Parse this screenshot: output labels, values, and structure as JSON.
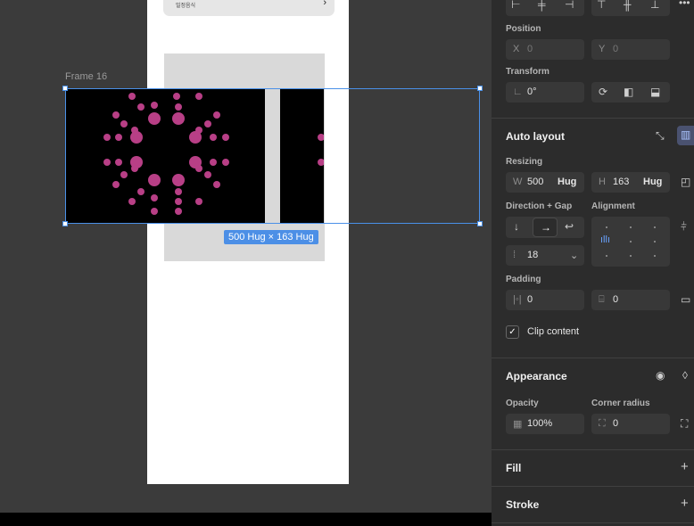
{
  "canvas": {
    "frame_label": "Frame 16",
    "size_badge": "500 Hug × 163 Hug",
    "top_card_text": "밀정음식",
    "dot_color": "#b83f86"
  },
  "panel": {
    "position": {
      "title": "Position",
      "x_key": "X",
      "x_value": "0",
      "y_key": "Y",
      "y_value": "0"
    },
    "transform": {
      "title": "Transform",
      "rotation": "0°"
    },
    "auto_layout": {
      "title": "Auto layout",
      "resizing_title": "Resizing",
      "w_key": "W",
      "w_value": "500",
      "w_mode": "Hug",
      "h_key": "H",
      "h_value": "163",
      "h_mode": "Hug",
      "direction_title": "Direction + Gap",
      "alignment_title": "Alignment",
      "gap_value": "18",
      "padding_title": "Padding",
      "padding_h": "0",
      "padding_v": "0",
      "clip_label": "Clip content"
    },
    "appearance": {
      "title": "Appearance",
      "opacity_title": "Opacity",
      "opacity_value": "100%",
      "radius_title": "Corner radius",
      "radius_value": "0"
    },
    "fill_title": "Fill",
    "stroke_title": "Stroke"
  }
}
